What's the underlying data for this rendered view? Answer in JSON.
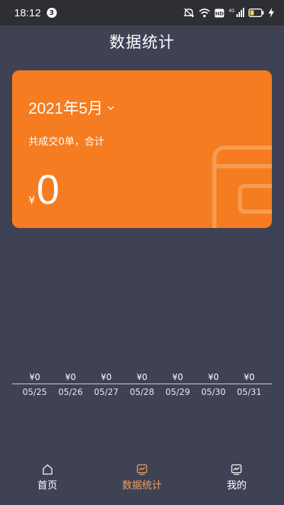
{
  "status_bar": {
    "time": "18:12",
    "notification_count": "3",
    "network": "4G",
    "hd": "HD",
    "icons": [
      "mute-icon",
      "wifi-icon",
      "hd-icon",
      "signal-icon",
      "battery-icon",
      "charging-icon"
    ]
  },
  "page": {
    "title": "数据统计"
  },
  "card": {
    "month": "2021年5月",
    "summary": "共成交0单，合计",
    "currency": "¥",
    "total": "0",
    "color": "#f57c20"
  },
  "week": {
    "values": [
      "¥0",
      "¥0",
      "¥0",
      "¥0",
      "¥0",
      "¥0",
      "¥0"
    ],
    "dates": [
      "05/25",
      "05/26",
      "05/27",
      "05/28",
      "05/29",
      "05/30",
      "05/31"
    ]
  },
  "tabs": [
    {
      "label": "首页",
      "icon": "home-icon",
      "active": false
    },
    {
      "label": "数据统计",
      "icon": "chart-icon",
      "active": true
    },
    {
      "label": "我的",
      "icon": "profile-chart-icon",
      "active": false
    }
  ],
  "colors": {
    "background": "#3f4254",
    "accent": "#f0a060"
  }
}
